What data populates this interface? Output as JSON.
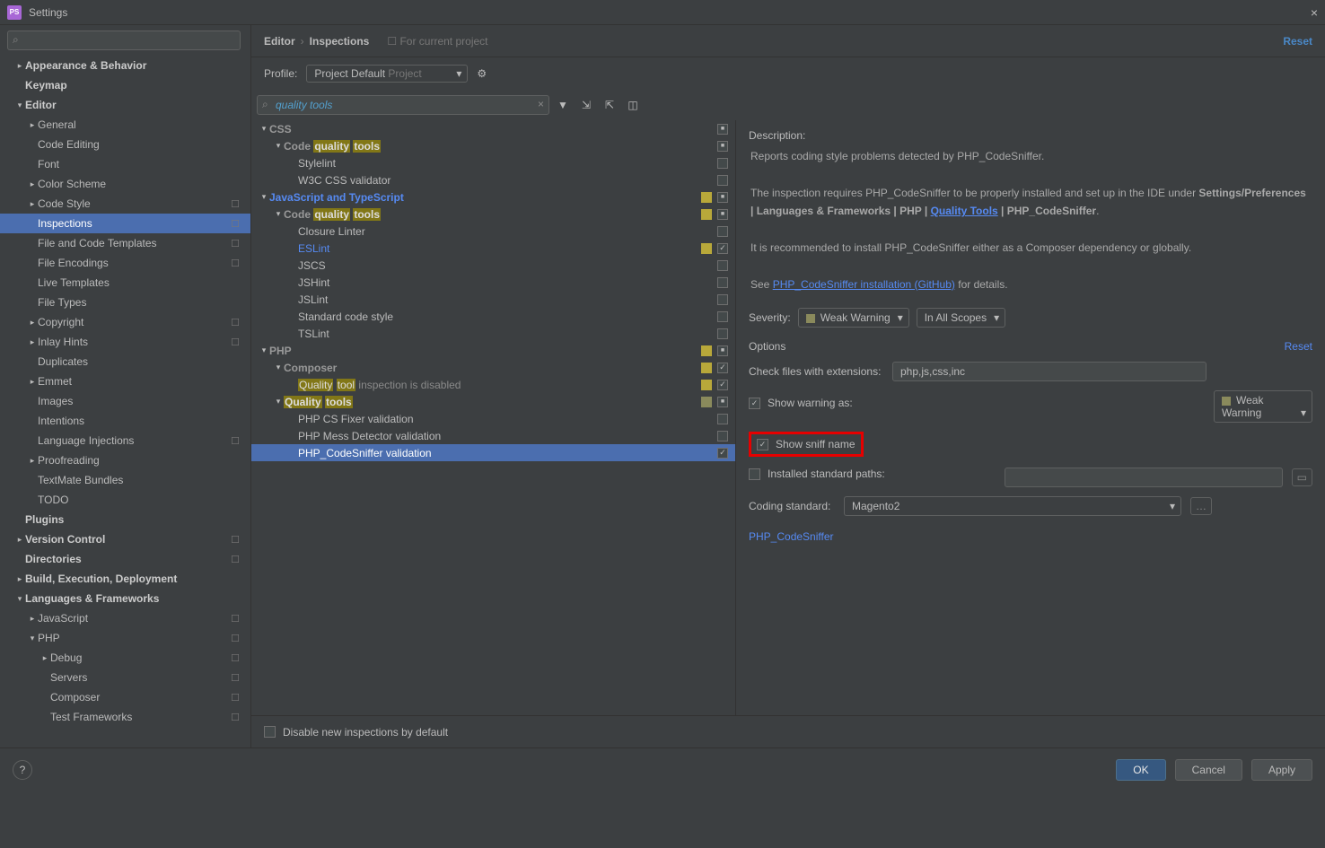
{
  "window": {
    "title": "Settings"
  },
  "sidebar_search_placeholder": "",
  "sidebar": [
    {
      "lbl": "Appearance & Behavior",
      "lvl": 0,
      "arr": "▸",
      "bold": true
    },
    {
      "lbl": "Keymap",
      "lvl": 0,
      "arr": "",
      "bold": true
    },
    {
      "lbl": "Editor",
      "lvl": 0,
      "arr": "▾",
      "bold": true
    },
    {
      "lbl": "General",
      "lvl": 1,
      "arr": "▸"
    },
    {
      "lbl": "Code Editing",
      "lvl": 1,
      "arr": ""
    },
    {
      "lbl": "Font",
      "lvl": 1,
      "arr": ""
    },
    {
      "lbl": "Color Scheme",
      "lvl": 1,
      "arr": "▸"
    },
    {
      "lbl": "Code Style",
      "lvl": 1,
      "arr": "▸",
      "mod": true
    },
    {
      "lbl": "Inspections",
      "lvl": 1,
      "arr": "",
      "mod": true,
      "sel": true
    },
    {
      "lbl": "File and Code Templates",
      "lvl": 1,
      "arr": "",
      "mod": true
    },
    {
      "lbl": "File Encodings",
      "lvl": 1,
      "arr": "",
      "mod": true
    },
    {
      "lbl": "Live Templates",
      "lvl": 1,
      "arr": ""
    },
    {
      "lbl": "File Types",
      "lvl": 1,
      "arr": ""
    },
    {
      "lbl": "Copyright",
      "lvl": 1,
      "arr": "▸",
      "mod": true
    },
    {
      "lbl": "Inlay Hints",
      "lvl": 1,
      "arr": "▸",
      "mod": true
    },
    {
      "lbl": "Duplicates",
      "lvl": 1,
      "arr": ""
    },
    {
      "lbl": "Emmet",
      "lvl": 1,
      "arr": "▸"
    },
    {
      "lbl": "Images",
      "lvl": 1,
      "arr": ""
    },
    {
      "lbl": "Intentions",
      "lvl": 1,
      "arr": ""
    },
    {
      "lbl": "Language Injections",
      "lvl": 1,
      "arr": "",
      "mod": true
    },
    {
      "lbl": "Proofreading",
      "lvl": 1,
      "arr": "▸"
    },
    {
      "lbl": "TextMate Bundles",
      "lvl": 1,
      "arr": ""
    },
    {
      "lbl": "TODO",
      "lvl": 1,
      "arr": ""
    },
    {
      "lbl": "Plugins",
      "lvl": 0,
      "arr": "",
      "bold": true
    },
    {
      "lbl": "Version Control",
      "lvl": 0,
      "arr": "▸",
      "bold": true,
      "mod": true
    },
    {
      "lbl": "Directories",
      "lvl": 0,
      "arr": "",
      "bold": true,
      "mod": true
    },
    {
      "lbl": "Build, Execution, Deployment",
      "lvl": 0,
      "arr": "▸",
      "bold": true
    },
    {
      "lbl": "Languages & Frameworks",
      "lvl": 0,
      "arr": "▾",
      "bold": true
    },
    {
      "lbl": "JavaScript",
      "lvl": 1,
      "arr": "▸",
      "mod": true
    },
    {
      "lbl": "PHP",
      "lvl": 1,
      "arr": "▾",
      "mod": true
    },
    {
      "lbl": "Debug",
      "lvl": 2,
      "arr": "▸",
      "mod": true
    },
    {
      "lbl": "Servers",
      "lvl": 2,
      "arr": "",
      "mod": true
    },
    {
      "lbl": "Composer",
      "lvl": 2,
      "arr": "",
      "mod": true
    },
    {
      "lbl": "Test Frameworks",
      "lvl": 2,
      "arr": "",
      "mod": true
    }
  ],
  "breadcrumb": {
    "a": "Editor",
    "b": "Inspections"
  },
  "project_hint": "For current project",
  "reset_top": "Reset",
  "profile": {
    "label": "Profile:",
    "name": "Project Default",
    "scope": "Project"
  },
  "insp_search": "quality tools",
  "insp_tree": [
    {
      "type": "cat",
      "lvl": 0,
      "arr": "▾",
      "pre": "",
      "hl": "",
      "post": "CSS",
      "chk": "mix"
    },
    {
      "type": "cat",
      "lvl": 1,
      "arr": "▾",
      "pre": "Code ",
      "hl": "quality",
      "hl2": "tools",
      "post": "",
      "chk": "mix"
    },
    {
      "type": "item",
      "lvl": 2,
      "lbl": "Stylelint",
      "chk": ""
    },
    {
      "type": "item",
      "lvl": 2,
      "lbl": "W3C CSS validator",
      "chk": ""
    },
    {
      "type": "linkcat",
      "lvl": 0,
      "arr": "▾",
      "lbl": "JavaScript and TypeScript",
      "chk": "mix",
      "sev": "yellow"
    },
    {
      "type": "cat",
      "lvl": 1,
      "arr": "▾",
      "pre": "Code ",
      "hl": "quality",
      "hl2": "tools",
      "post": "",
      "chk": "mix",
      "sev": "yellow"
    },
    {
      "type": "item",
      "lvl": 2,
      "lbl": "Closure Linter",
      "chk": ""
    },
    {
      "type": "linkitem",
      "lvl": 2,
      "lbl": "ESLint",
      "chk": "on",
      "sev": "yellow"
    },
    {
      "type": "item",
      "lvl": 2,
      "lbl": "JSCS",
      "chk": ""
    },
    {
      "type": "item",
      "lvl": 2,
      "lbl": "JSHint",
      "chk": ""
    },
    {
      "type": "item",
      "lvl": 2,
      "lbl": "JSLint",
      "chk": ""
    },
    {
      "type": "item",
      "lvl": 2,
      "lbl": "Standard code style",
      "chk": ""
    },
    {
      "type": "item",
      "lvl": 2,
      "lbl": "TSLint",
      "chk": ""
    },
    {
      "type": "cat",
      "lvl": 0,
      "arr": "▾",
      "pre": "",
      "hl": "",
      "post": "PHP",
      "chk": "mix",
      "sev": "yellow"
    },
    {
      "type": "cat",
      "lvl": 1,
      "arr": "▾",
      "pre": "",
      "hl": "",
      "post": "Composer",
      "chk": "on",
      "sev": "yellow"
    },
    {
      "type": "comp",
      "lvl": 2,
      "pre": "",
      "hl": "Quality",
      "hl2": "tool",
      "post": " inspection is disabled",
      "chk": "on",
      "sev": "yellow"
    },
    {
      "type": "qtcat",
      "lvl": 1,
      "arr": "▾",
      "hl": "Quality",
      "hl2": "tools",
      "chk": "mix",
      "sev": "olive"
    },
    {
      "type": "item",
      "lvl": 2,
      "lbl": "PHP CS Fixer validation",
      "chk": ""
    },
    {
      "type": "item",
      "lvl": 2,
      "lbl": "PHP Mess Detector validation",
      "chk": ""
    },
    {
      "type": "item",
      "lvl": 2,
      "lbl": "PHP_CodeSniffer validation",
      "chk": "on",
      "sel": true
    }
  ],
  "detail": {
    "desc_label": "Description:",
    "desc_p1": "Reports coding style problems detected by PHP_CodeSniffer.",
    "desc_p2a": "The inspection requires PHP_CodeSniffer to be properly installed and set up in the IDE under ",
    "desc_p2b": "Settings/Preferences | Languages & Frameworks | PHP | ",
    "desc_p2_link": "Quality Tools",
    "desc_p2c": " | PHP_CodeSniffer",
    "desc_p3": "It is recommended to install PHP_CodeSniffer either as a Composer dependency or globally.",
    "desc_p4a": "See ",
    "desc_p4_link": "PHP_CodeSniffer installation (GitHub)",
    "desc_p4b": " for details.",
    "severity_label": "Severity:",
    "severity_value": "Weak Warning",
    "scope_value": "In All Scopes",
    "options_label": "Options",
    "reset": "Reset",
    "ext_label": "Check files with extensions:",
    "ext_value": "php,js,css,inc",
    "show_warning_label": "Show warning as:",
    "show_warning_value": "Weak Warning",
    "sniff_label": "Show sniff name",
    "installed_label": "Installed standard paths:",
    "installed_value": "",
    "standard_label": "Coding standard:",
    "standard_value": "Magento2",
    "phpcs_link": "PHP_CodeSniffer"
  },
  "bottom_cb_label": "Disable new inspections by default",
  "buttons": {
    "ok": "OK",
    "cancel": "Cancel",
    "apply": "Apply"
  }
}
